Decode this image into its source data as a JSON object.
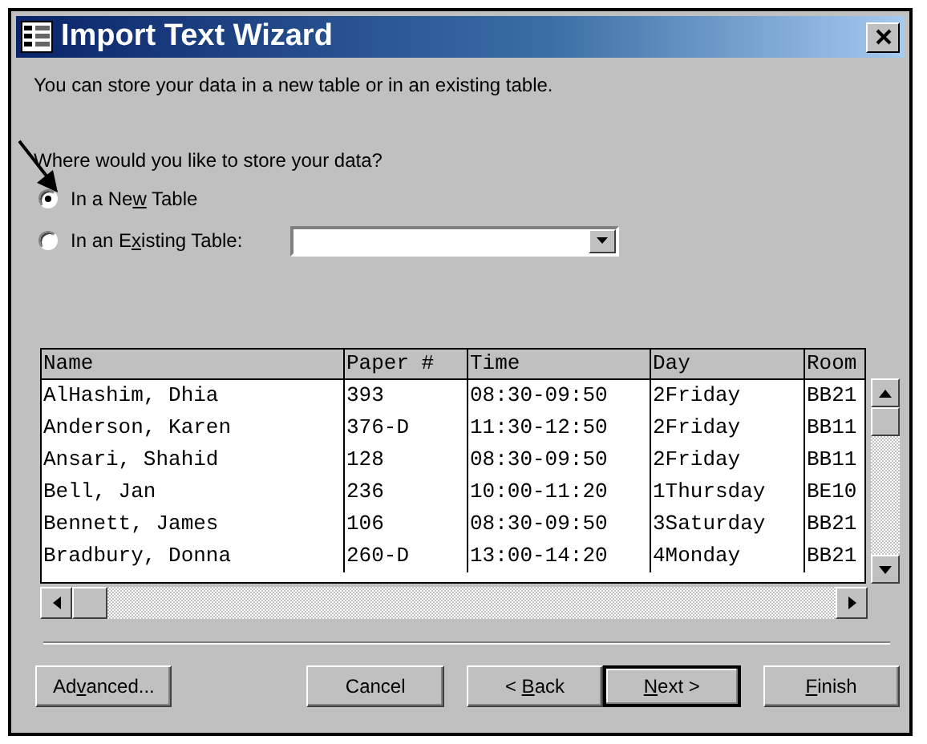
{
  "window": {
    "title": "Import Text Wizard"
  },
  "description": "You can store your data in a new table or in an existing table.",
  "question": "Where would you like to store your data?",
  "options": [
    {
      "text_before": "In a Ne",
      "access_key": "w",
      "text_after": " Table",
      "selected": true
    },
    {
      "text_before": "In an E",
      "access_key": "x",
      "text_after": "isting Table:",
      "selected": false
    }
  ],
  "preview": {
    "columns": [
      "Name",
      "Paper #",
      "Time",
      "Day",
      "Room"
    ],
    "rows": [
      [
        "AlHashim, Dhia",
        "393",
        "08:30-09:50",
        "2Friday",
        "BB21"
      ],
      [
        "Anderson, Karen",
        "376-D",
        "11:30-12:50",
        "2Friday",
        "BB11"
      ],
      [
        "Ansari, Shahid",
        "128",
        "08:30-09:50",
        "2Friday",
        "BB11"
      ],
      [
        "Bell, Jan",
        "236",
        "10:00-11:20",
        "1Thursday",
        "BE10"
      ],
      [
        "Bennett, James",
        "106",
        "08:30-09:50",
        "3Saturday",
        "BB21"
      ],
      [
        "Bradbury, Donna",
        "260-D",
        "13:00-14:20",
        "4Monday",
        "BB21"
      ]
    ]
  },
  "buttons": [
    {
      "text_before": "Ad",
      "access_key": "v",
      "text_after": "anced...",
      "default": false
    },
    {
      "text_before": "Cancel",
      "default": false
    },
    {
      "text_before": "< ",
      "access_key": "B",
      "text_after": "ack",
      "default": false
    },
    {
      "access_key": "N",
      "text_after": "ext >",
      "default": true
    },
    {
      "access_key": "F",
      "text_after": "inish",
      "default": false
    }
  ]
}
